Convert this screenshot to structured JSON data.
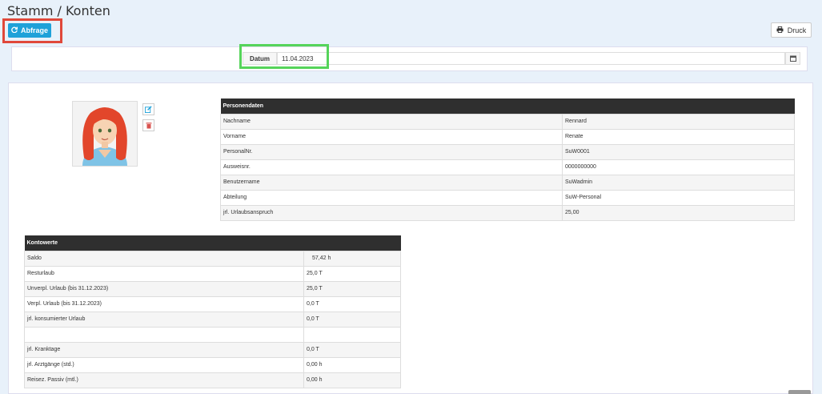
{
  "page": {
    "title": "Stamm / Konten"
  },
  "toolbar": {
    "query_label": "Abfrage",
    "print_label": "Druck"
  },
  "filter": {
    "date_label": "Datum",
    "date_value": "11.04.2023"
  },
  "person": {
    "title": "Personendaten",
    "rows": [
      {
        "label": "Nachname",
        "value": "Rennard"
      },
      {
        "label": "Vorname",
        "value": "Renate"
      },
      {
        "label": "PersonalNr.",
        "value": "SuW0001"
      },
      {
        "label": "Ausweisnr.",
        "value": "0000000000"
      },
      {
        "label": "Benutzername",
        "value": "SuWadmin"
      },
      {
        "label": "Abteilung",
        "value": "SuW-Personal"
      },
      {
        "label": "jrl. Urlaubsanspruch",
        "value": "25,00"
      }
    ]
  },
  "accounts": {
    "title": "Kontowerte",
    "rows": [
      {
        "label": "Saldo",
        "value": "57,42  h"
      },
      {
        "label": "Resturlaub",
        "value": "25,0  T"
      },
      {
        "label": "Unverpl. Urlaub (bis 31.12.2023)",
        "value": "25,0  T"
      },
      {
        "label": "Verpl. Urlaub (bis 31.12.2023)",
        "value": "0,0  T"
      },
      {
        "label": "jrl. konsumierter Urlaub",
        "value": "0,0  T"
      },
      {
        "label": "",
        "value": ""
      },
      {
        "label": "jrl. Kranktage",
        "value": "0,0  T"
      },
      {
        "label": "jrl. Arztgänge (std.)",
        "value": "0,00  h"
      },
      {
        "label": "Reisez. Passiv (mtl.)",
        "value": "0,00  h"
      }
    ]
  },
  "colors": {
    "accent": "#1ea1d9",
    "header_bg": "#2f2f2f",
    "highlight_red": "#e0483a",
    "highlight_green": "#55d45a"
  },
  "icons": {
    "query": "refresh-icon",
    "print": "printer-icon",
    "calendar": "calendar-icon",
    "edit": "edit-icon",
    "delete": "trash-icon"
  }
}
